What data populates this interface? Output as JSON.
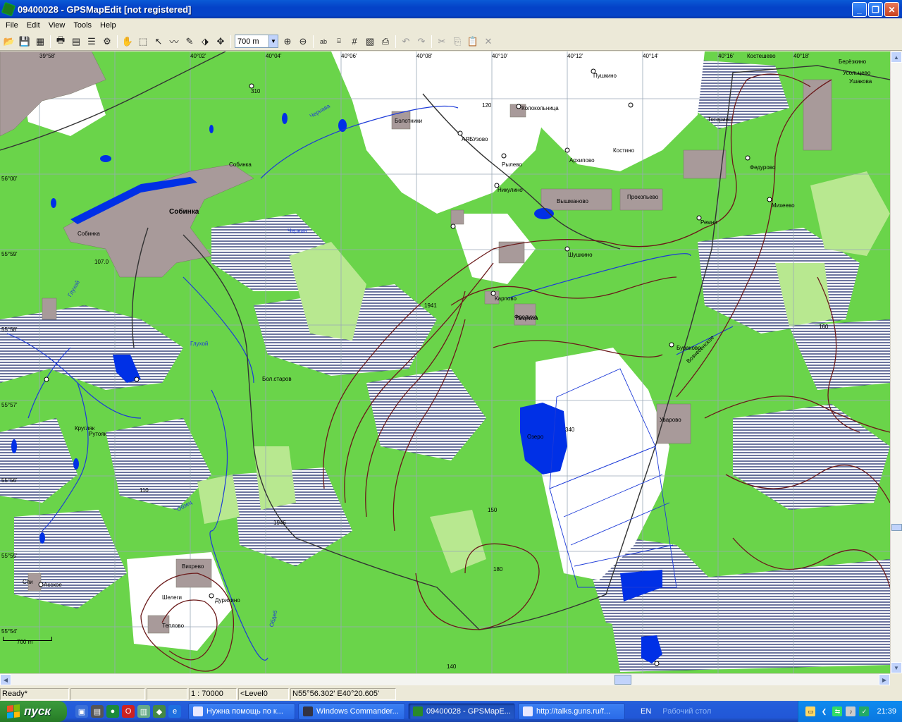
{
  "window": {
    "title": "09400028 - GPSMapEdit [not registered]",
    "controls": [
      "_",
      "❐",
      "✕"
    ]
  },
  "menu": [
    "File",
    "Edit",
    "View",
    "Tools",
    "Help"
  ],
  "toolbar": {
    "scale_value": "700 m",
    "icons": [
      "open-icon",
      "save-icon",
      "save-as-icon",
      "print-icon",
      "print-preview-icon",
      "properties-icon",
      "measure-icon",
      "hand-icon",
      "zoom-rect-icon",
      "select-icon",
      "polyline-icon",
      "node-icon",
      "transform-icon",
      "move-icon",
      "zoom-in-icon",
      "zoom-out-icon",
      "labels-icon",
      "grid-labels-icon",
      "grid-icon",
      "hatch-icon",
      "paste-object-icon",
      "undo-icon",
      "redo-icon",
      "cut-icon",
      "copy-icon",
      "paste-icon",
      "delete-icon"
    ]
  },
  "map": {
    "lon_ticks": [
      "39°58'",
      "40°02'",
      "40°04'",
      "40°06'",
      "40°08'",
      "40°10'",
      "40°12'",
      "40°14'",
      "40°16'",
      "40°18'"
    ],
    "lat_ticks": [
      "56°00'",
      "55°59'",
      "55°58'",
      "55°57'",
      "55°56'",
      "55°55'",
      "55°54'"
    ],
    "place_labels": [
      "Собинка",
      "Собинка",
      "Собинка",
      "107.0",
      "Глухой",
      "Глухой",
      "Черная",
      "Чернава",
      "Бол.старов",
      "Кругляк",
      "Рутояк",
      "Обзец",
      "Обдеб",
      "Спи",
      "Асское",
      "Вихрево",
      "Шелеги",
      "Дурихино",
      "Теплово",
      "Болотники",
      "АЯБУзово",
      "Колокольница",
      "Рылево",
      "Никулино",
      "Архипово",
      "Вышманово",
      "Карпово",
      "Фролиха",
      "Шушкино",
      "Пушкино",
      "Прокопьево",
      "Костино",
      "Михеево",
      "Уварово",
      "Федурово",
      "Костешево",
      "Усольцево",
      "Тетерино",
      "Ремни",
      "Бураково",
      "Вознесенское",
      "Берёзкино",
      "Ушакова",
      "Лицеиха",
      "Озеро",
      "1946",
      "1941",
      "110",
      "120",
      "140",
      "150",
      "160",
      "180",
      "310",
      "340"
    ],
    "scale_bar": "700 m"
  },
  "status": {
    "ready": "Ready*",
    "scale": "1 : 70000",
    "level": "<Level0",
    "coords": "N55°56.302' E40°20.605'"
  },
  "taskbar": {
    "start_label": "пуск",
    "tasks": [
      "Нужна помощь по к...",
      "Windows Commander...",
      "09400028 - GPSMapE...",
      "http://talks.guns.ru/f..."
    ],
    "active_task_index": 2,
    "language": "EN",
    "desktop_label": "Рабочий стол",
    "clock": "21:39"
  },
  "colors": {
    "forest": "#6ad44a",
    "light_forest": "#b8e890",
    "water": "#0030e6",
    "town": "#a89a9a",
    "contour": "#6b1a1a",
    "grid": "#9aa9b6"
  }
}
